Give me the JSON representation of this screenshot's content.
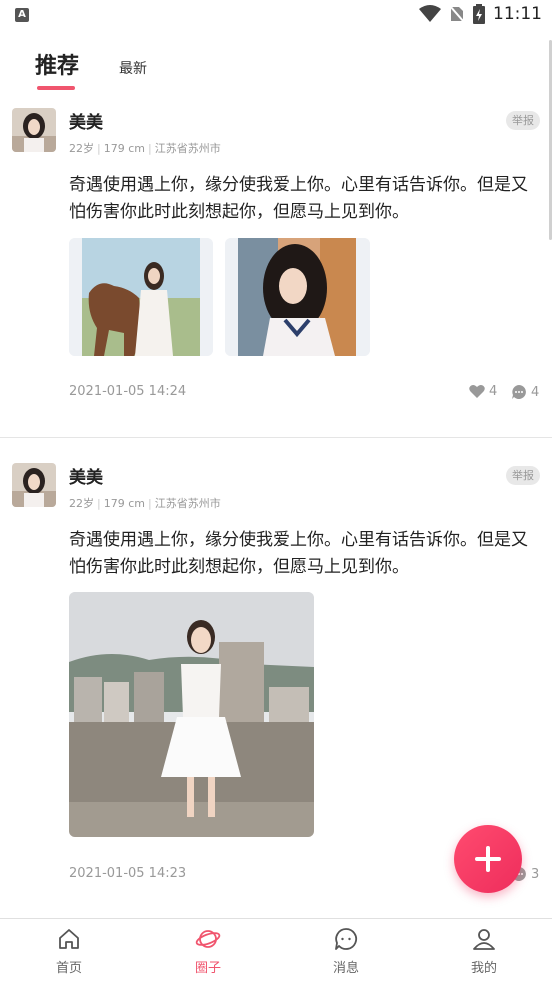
{
  "status_bar": {
    "time": "11:11"
  },
  "tabs": [
    {
      "label": "推荐",
      "active": true
    },
    {
      "label": "最新",
      "active": false
    }
  ],
  "posts": [
    {
      "username": "美美",
      "age": "22岁",
      "height": "179 cm",
      "location": "江苏省苏州市",
      "report_label": "举报",
      "content": "奇遇使用遇上你，缘分使我爱上你。心里有话告诉你。但是又怕伤害你此时此刻想起你，但愿马上见到你。",
      "date": "2021-01-05 14:24",
      "likes": "4",
      "comments": "4"
    },
    {
      "username": "美美",
      "age": "22岁",
      "height": "179 cm",
      "location": "江苏省苏州市",
      "report_label": "举报",
      "content": "奇遇使用遇上你，缘分使我爱上你。心里有话告诉你。但是又怕伤害你此时此刻想起你，但愿马上见到你。",
      "date": "2021-01-05 14:23",
      "comments": "3"
    }
  ],
  "nav": [
    {
      "label": "首页",
      "icon": "home-icon"
    },
    {
      "label": "圈子",
      "icon": "planet-icon",
      "active": true
    },
    {
      "label": "消息",
      "icon": "chat-bubble-icon"
    },
    {
      "label": "我的",
      "icon": "user-icon"
    }
  ],
  "colors": {
    "accent": "#f0556e",
    "fab": "#ee2d5c"
  }
}
